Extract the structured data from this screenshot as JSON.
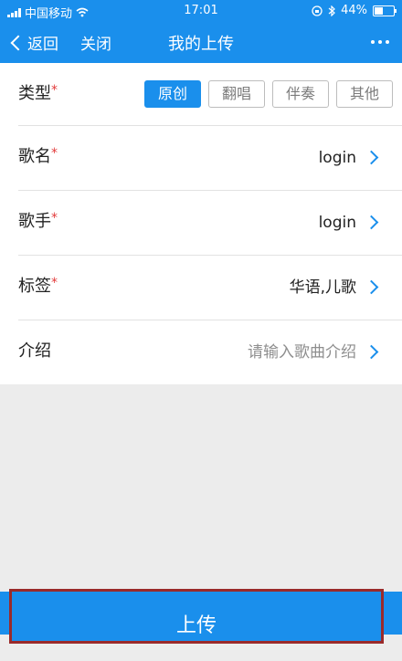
{
  "status": {
    "carrier": "中国移动",
    "time": "17:01",
    "battery": "44%",
    "battery_level": 0.44
  },
  "nav": {
    "back_label": "返回",
    "close_label": "关闭",
    "title": "我的上传"
  },
  "form": {
    "type": {
      "label": "类型",
      "required_mark": "*",
      "options": [
        "原创",
        "翻唱",
        "伴奏",
        "其他"
      ],
      "selected": "原创"
    },
    "song_name": {
      "label": "歌名",
      "required_mark": "*",
      "value": "login"
    },
    "singer": {
      "label": "歌手",
      "required_mark": "*",
      "value": "login"
    },
    "tags": {
      "label": "标签",
      "required_mark": "*",
      "value": "华语,儿歌"
    },
    "intro": {
      "label": "介绍",
      "placeholder": "请输入歌曲介绍"
    }
  },
  "upload": {
    "label": "上传"
  },
  "colors": {
    "accent": "#1a8fec",
    "required": "#e23b3b",
    "highlight_border": "#9a2a2a"
  }
}
